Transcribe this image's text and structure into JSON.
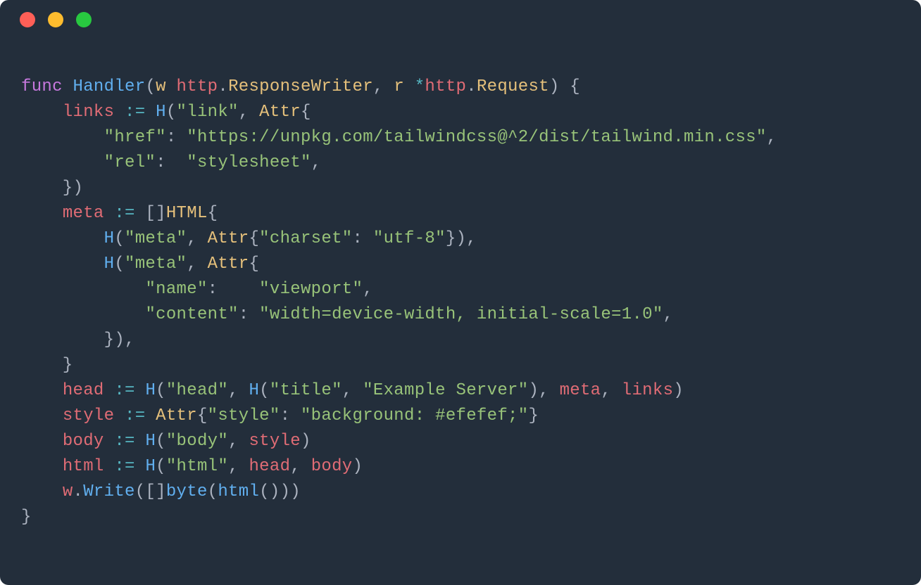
{
  "code": {
    "tokens": [
      [
        {
          "t": "func ",
          "c": "tok-keyword"
        },
        {
          "t": "Handler",
          "c": "tok-func"
        },
        {
          "t": "(",
          "c": "tok-punct"
        },
        {
          "t": "w",
          "c": "tok-param"
        },
        {
          "t": " ",
          "c": "tok-plain"
        },
        {
          "t": "http",
          "c": "tok-ident"
        },
        {
          "t": ".",
          "c": "tok-punct"
        },
        {
          "t": "ResponseWriter",
          "c": "tok-type"
        },
        {
          "t": ", ",
          "c": "tok-punct"
        },
        {
          "t": "r",
          "c": "tok-param"
        },
        {
          "t": " ",
          "c": "tok-plain"
        },
        {
          "t": "*",
          "c": "tok-oper"
        },
        {
          "t": "http",
          "c": "tok-ident"
        },
        {
          "t": ".",
          "c": "tok-punct"
        },
        {
          "t": "Request",
          "c": "tok-type"
        },
        {
          "t": ") {",
          "c": "tok-punct"
        }
      ],
      [
        {
          "t": "    ",
          "c": "tok-plain"
        },
        {
          "t": "links",
          "c": "tok-ident"
        },
        {
          "t": " ",
          "c": "tok-plain"
        },
        {
          "t": ":=",
          "c": "tok-oper"
        },
        {
          "t": " ",
          "c": "tok-plain"
        },
        {
          "t": "H",
          "c": "tok-call"
        },
        {
          "t": "(",
          "c": "tok-punct"
        },
        {
          "t": "\"link\"",
          "c": "tok-string"
        },
        {
          "t": ", ",
          "c": "tok-punct"
        },
        {
          "t": "Attr",
          "c": "tok-type"
        },
        {
          "t": "{",
          "c": "tok-punct"
        }
      ],
      [
        {
          "t": "        ",
          "c": "tok-plain"
        },
        {
          "t": "\"href\"",
          "c": "tok-string"
        },
        {
          "t": ": ",
          "c": "tok-punct"
        },
        {
          "t": "\"https://unpkg.com/tailwindcss@^2/dist/tailwind.min.css\"",
          "c": "tok-string"
        },
        {
          "t": ",",
          "c": "tok-punct"
        }
      ],
      [
        {
          "t": "        ",
          "c": "tok-plain"
        },
        {
          "t": "\"rel\"",
          "c": "tok-string"
        },
        {
          "t": ":  ",
          "c": "tok-punct"
        },
        {
          "t": "\"stylesheet\"",
          "c": "tok-string"
        },
        {
          "t": ",",
          "c": "tok-punct"
        }
      ],
      [
        {
          "t": "    })",
          "c": "tok-punct"
        }
      ],
      [
        {
          "t": "    ",
          "c": "tok-plain"
        },
        {
          "t": "meta",
          "c": "tok-ident"
        },
        {
          "t": " ",
          "c": "tok-plain"
        },
        {
          "t": ":=",
          "c": "tok-oper"
        },
        {
          "t": " []",
          "c": "tok-punct"
        },
        {
          "t": "HTML",
          "c": "tok-type"
        },
        {
          "t": "{",
          "c": "tok-punct"
        }
      ],
      [
        {
          "t": "        ",
          "c": "tok-plain"
        },
        {
          "t": "H",
          "c": "tok-call"
        },
        {
          "t": "(",
          "c": "tok-punct"
        },
        {
          "t": "\"meta\"",
          "c": "tok-string"
        },
        {
          "t": ", ",
          "c": "tok-punct"
        },
        {
          "t": "Attr",
          "c": "tok-type"
        },
        {
          "t": "{",
          "c": "tok-punct"
        },
        {
          "t": "\"charset\"",
          "c": "tok-string"
        },
        {
          "t": ": ",
          "c": "tok-punct"
        },
        {
          "t": "\"utf-8\"",
          "c": "tok-string"
        },
        {
          "t": "}),",
          "c": "tok-punct"
        }
      ],
      [
        {
          "t": "        ",
          "c": "tok-plain"
        },
        {
          "t": "H",
          "c": "tok-call"
        },
        {
          "t": "(",
          "c": "tok-punct"
        },
        {
          "t": "\"meta\"",
          "c": "tok-string"
        },
        {
          "t": ", ",
          "c": "tok-punct"
        },
        {
          "t": "Attr",
          "c": "tok-type"
        },
        {
          "t": "{",
          "c": "tok-punct"
        }
      ],
      [
        {
          "t": "            ",
          "c": "tok-plain"
        },
        {
          "t": "\"name\"",
          "c": "tok-string"
        },
        {
          "t": ":    ",
          "c": "tok-punct"
        },
        {
          "t": "\"viewport\"",
          "c": "tok-string"
        },
        {
          "t": ",",
          "c": "tok-punct"
        }
      ],
      [
        {
          "t": "            ",
          "c": "tok-plain"
        },
        {
          "t": "\"content\"",
          "c": "tok-string"
        },
        {
          "t": ": ",
          "c": "tok-punct"
        },
        {
          "t": "\"width=device-width, initial-scale=1.0\"",
          "c": "tok-string"
        },
        {
          "t": ",",
          "c": "tok-punct"
        }
      ],
      [
        {
          "t": "        }),",
          "c": "tok-punct"
        }
      ],
      [
        {
          "t": "    }",
          "c": "tok-punct"
        }
      ],
      [
        {
          "t": "    ",
          "c": "tok-plain"
        },
        {
          "t": "head",
          "c": "tok-ident"
        },
        {
          "t": " ",
          "c": "tok-plain"
        },
        {
          "t": ":=",
          "c": "tok-oper"
        },
        {
          "t": " ",
          "c": "tok-plain"
        },
        {
          "t": "H",
          "c": "tok-call"
        },
        {
          "t": "(",
          "c": "tok-punct"
        },
        {
          "t": "\"head\"",
          "c": "tok-string"
        },
        {
          "t": ", ",
          "c": "tok-punct"
        },
        {
          "t": "H",
          "c": "tok-call"
        },
        {
          "t": "(",
          "c": "tok-punct"
        },
        {
          "t": "\"title\"",
          "c": "tok-string"
        },
        {
          "t": ", ",
          "c": "tok-punct"
        },
        {
          "t": "\"Example Server\"",
          "c": "tok-string"
        },
        {
          "t": "), ",
          "c": "tok-punct"
        },
        {
          "t": "meta",
          "c": "tok-ident"
        },
        {
          "t": ", ",
          "c": "tok-punct"
        },
        {
          "t": "links",
          "c": "tok-ident"
        },
        {
          "t": ")",
          "c": "tok-punct"
        }
      ],
      [
        {
          "t": "    ",
          "c": "tok-plain"
        },
        {
          "t": "style",
          "c": "tok-ident"
        },
        {
          "t": " ",
          "c": "tok-plain"
        },
        {
          "t": ":=",
          "c": "tok-oper"
        },
        {
          "t": " ",
          "c": "tok-plain"
        },
        {
          "t": "Attr",
          "c": "tok-type"
        },
        {
          "t": "{",
          "c": "tok-punct"
        },
        {
          "t": "\"style\"",
          "c": "tok-string"
        },
        {
          "t": ": ",
          "c": "tok-punct"
        },
        {
          "t": "\"background: #efefef;\"",
          "c": "tok-string"
        },
        {
          "t": "}",
          "c": "tok-punct"
        }
      ],
      [
        {
          "t": "    ",
          "c": "tok-plain"
        },
        {
          "t": "body",
          "c": "tok-ident"
        },
        {
          "t": " ",
          "c": "tok-plain"
        },
        {
          "t": ":=",
          "c": "tok-oper"
        },
        {
          "t": " ",
          "c": "tok-plain"
        },
        {
          "t": "H",
          "c": "tok-call"
        },
        {
          "t": "(",
          "c": "tok-punct"
        },
        {
          "t": "\"body\"",
          "c": "tok-string"
        },
        {
          "t": ", ",
          "c": "tok-punct"
        },
        {
          "t": "style",
          "c": "tok-ident"
        },
        {
          "t": ")",
          "c": "tok-punct"
        }
      ],
      [
        {
          "t": "    ",
          "c": "tok-plain"
        },
        {
          "t": "html",
          "c": "tok-ident"
        },
        {
          "t": " ",
          "c": "tok-plain"
        },
        {
          "t": ":=",
          "c": "tok-oper"
        },
        {
          "t": " ",
          "c": "tok-plain"
        },
        {
          "t": "H",
          "c": "tok-call"
        },
        {
          "t": "(",
          "c": "tok-punct"
        },
        {
          "t": "\"html\"",
          "c": "tok-string"
        },
        {
          "t": ", ",
          "c": "tok-punct"
        },
        {
          "t": "head",
          "c": "tok-ident"
        },
        {
          "t": ", ",
          "c": "tok-punct"
        },
        {
          "t": "body",
          "c": "tok-ident"
        },
        {
          "t": ")",
          "c": "tok-punct"
        }
      ],
      [
        {
          "t": "    ",
          "c": "tok-plain"
        },
        {
          "t": "w",
          "c": "tok-ident"
        },
        {
          "t": ".",
          "c": "tok-punct"
        },
        {
          "t": "Write",
          "c": "tok-call"
        },
        {
          "t": "([]",
          "c": "tok-punct"
        },
        {
          "t": "byte",
          "c": "tok-call"
        },
        {
          "t": "(",
          "c": "tok-punct"
        },
        {
          "t": "html",
          "c": "tok-call"
        },
        {
          "t": "()))",
          "c": "tok-punct"
        }
      ],
      [
        {
          "t": "}",
          "c": "tok-punct"
        }
      ]
    ]
  }
}
